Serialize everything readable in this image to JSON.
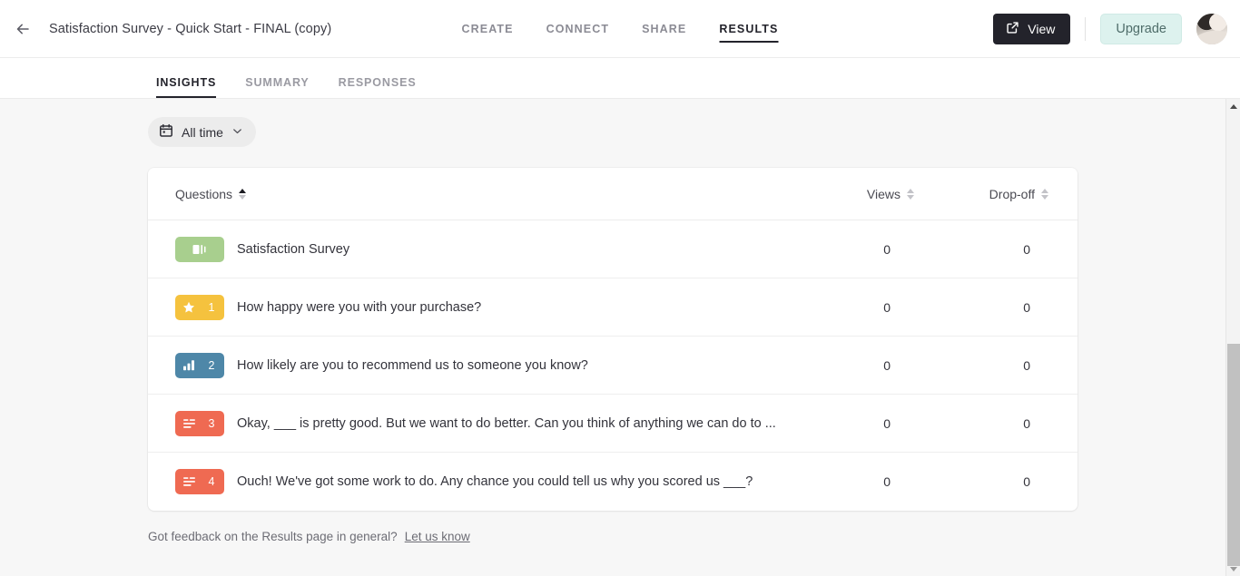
{
  "header": {
    "back_icon": "arrow-left-icon",
    "doc_title": "Satisfaction Survey - Quick Start - FINAL (copy)",
    "nav": [
      {
        "label": "CREATE",
        "active": false
      },
      {
        "label": "CONNECT",
        "active": false
      },
      {
        "label": "SHARE",
        "active": false
      },
      {
        "label": "RESULTS",
        "active": true
      }
    ],
    "view_button": {
      "label": "View",
      "icon": "external-link-icon"
    },
    "upgrade_button": {
      "label": "Upgrade"
    },
    "avatar": {
      "name": "user-avatar"
    }
  },
  "subtabs": [
    {
      "label": "INSIGHTS",
      "active": true
    },
    {
      "label": "SUMMARY",
      "active": false
    },
    {
      "label": "RESPONSES",
      "active": false
    }
  ],
  "filter": {
    "icon": "calendar-icon",
    "label": "All time",
    "chevron": "chevron-down-icon"
  },
  "table": {
    "columns": [
      {
        "label": "Questions",
        "sort": "asc"
      },
      {
        "label": "Views",
        "sort": "none"
      },
      {
        "label": "Drop-off",
        "sort": "none"
      }
    ],
    "rows": [
      {
        "badge": {
          "glyph": "welcome-screen-icon",
          "number": "",
          "color": "#a8cf8e"
        },
        "question": "Satisfaction Survey",
        "views": "0",
        "dropoff": "0"
      },
      {
        "badge": {
          "glyph": "star-rating-icon",
          "number": "1",
          "color": "#f5c23e"
        },
        "question": "How happy were you with your purchase?",
        "views": "0",
        "dropoff": "0"
      },
      {
        "badge": {
          "glyph": "bar-chart-icon",
          "number": "2",
          "color": "#4e87a8"
        },
        "question": "How likely are you to recommend us to someone you know?",
        "views": "0",
        "dropoff": "0"
      },
      {
        "badge": {
          "glyph": "long-text-icon",
          "number": "3",
          "color": "#ef6a52"
        },
        "question": "Okay, ___ is pretty good. But we want to do better. Can you think of anything we can do to ...",
        "views": "0",
        "dropoff": "0"
      },
      {
        "badge": {
          "glyph": "long-text-icon",
          "number": "4",
          "color": "#ef6a52"
        },
        "question": "Ouch! We've got some work to do. Any chance you could tell us why you scored us ___?",
        "views": "0",
        "dropoff": "0"
      }
    ]
  },
  "footer": {
    "text": "Got feedback on the Results page in general?",
    "link": "Let us know"
  },
  "scrollbar": {
    "up_icon": "scroll-up-arrow-icon",
    "down_icon": "scroll-down-arrow-icon"
  },
  "colors": {
    "dark": "#23232b",
    "page_bg": "#f7f7f7",
    "upgrade_bg": "#ddf2ee"
  }
}
